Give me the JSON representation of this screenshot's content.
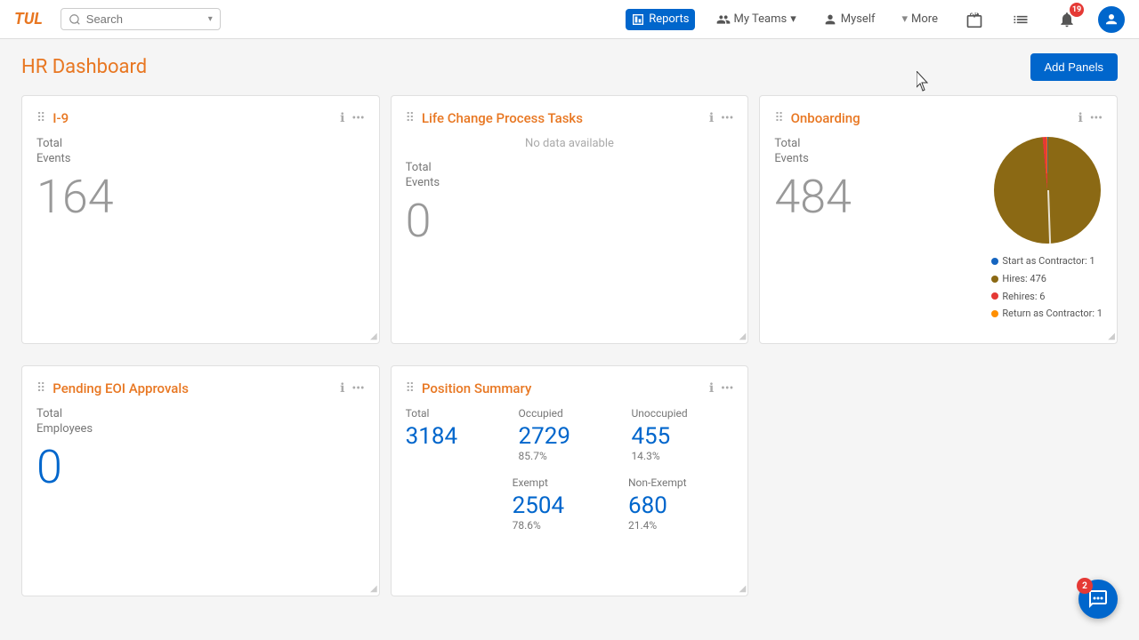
{
  "app": {
    "logo": "TUL"
  },
  "navbar": {
    "search_placeholder": "Search",
    "reports_label": "Reports",
    "my_teams_label": "My Teams",
    "myself_label": "Myself",
    "more_label": "More",
    "notifications_count": "19",
    "chat_count": "2"
  },
  "page": {
    "title": "HR Dashboard",
    "add_panels_label": "Add Panels",
    "cursor_label": "cursor"
  },
  "panels": {
    "i9": {
      "title": "I-9",
      "total_label": "Total",
      "events_label": "Events",
      "value": "164"
    },
    "life_change": {
      "title": "Life Change Process Tasks",
      "total_label": "Total",
      "events_label": "Events",
      "value": "0",
      "no_data": "No data available"
    },
    "onboarding": {
      "title": "Onboarding",
      "total_label": "Total",
      "events_label": "Events",
      "value": "484",
      "legend": [
        {
          "label": "Start as Contractor: 1",
          "color": "#1565C0"
        },
        {
          "label": "Hires: 476",
          "color": "#8B6914"
        },
        {
          "label": "Rehires: 6",
          "color": "#e53935"
        },
        {
          "label": "Return as Contractor: 1",
          "color": "#FF8F00"
        }
      ],
      "pie_segments": [
        {
          "value": 1,
          "color": "#1565C0"
        },
        {
          "value": 476,
          "color": "#8B6914"
        },
        {
          "value": 6,
          "color": "#e53935"
        },
        {
          "value": 1,
          "color": "#FF8F00"
        }
      ]
    },
    "pending_eoi": {
      "title": "Pending EOI Approvals",
      "total_label": "Total",
      "employees_label": "Employees",
      "value": "0"
    },
    "position_summary": {
      "title": "Position Summary",
      "total_label": "Total",
      "total_value": "3184",
      "occupied_label": "Occupied",
      "occupied_value": "2729",
      "occupied_pct": "85.7%",
      "unoccupied_label": "Unoccupied",
      "unoccupied_value": "455",
      "unoccupied_pct": "14.3%",
      "exempt_label": "Exempt",
      "exempt_value": "2504",
      "exempt_pct": "78.6%",
      "non_exempt_label": "Non-Exempt",
      "non_exempt_value": "680",
      "non_exempt_pct": "21.4%"
    }
  }
}
